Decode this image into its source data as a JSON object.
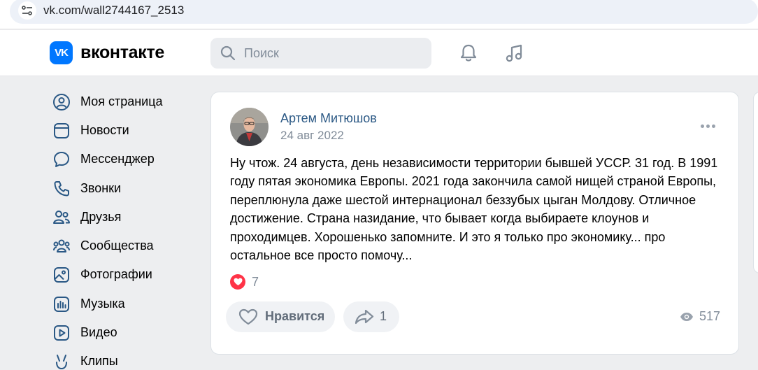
{
  "browser": {
    "url": "vk.com/wall2744167_2513"
  },
  "header": {
    "logo_text": "вконтакте",
    "logo_mark": "VK",
    "search_placeholder": "Поиск",
    "icons": [
      "search-icon",
      "bell-icon",
      "music-icon"
    ]
  },
  "sidebar": {
    "items": [
      {
        "label": "Моя страница",
        "icon": "user-circle-icon"
      },
      {
        "label": "Новости",
        "icon": "news-icon"
      },
      {
        "label": "Мессенджер",
        "icon": "message-icon"
      },
      {
        "label": "Звонки",
        "icon": "phone-icon"
      },
      {
        "label": "Друзья",
        "icon": "friends-icon"
      },
      {
        "label": "Сообщества",
        "icon": "communities-icon"
      },
      {
        "label": "Фотографии",
        "icon": "photo-icon"
      },
      {
        "label": "Музыка",
        "icon": "music-bars-icon"
      },
      {
        "label": "Видео",
        "icon": "video-icon"
      },
      {
        "label": "Клипы",
        "icon": "clips-icon"
      }
    ]
  },
  "post": {
    "author": "Артем Митюшов",
    "date": "24 авг 2022",
    "text": "Ну чтож. 24 августа, день независимости территории бывшей УССР. 31 год. В 1991 году пятая экономика Европы. 2021 года закончила самой нищей страной Европы, переплюнула даже шестой интернационал беззубых цыган Молдову. Отличное достижение. Страна назидание, что бывает когда выбираете клоунов и проходимцев. Хорошенько запомните. И это я только про экономику... про остальное все просто помочу...",
    "reactions_count": "7",
    "like_label": "Нравится",
    "shares_count": "1",
    "views_count": "517"
  },
  "colors": {
    "brand": "#0077ff",
    "author_link": "#2c5985",
    "secondary_text": "#818c99",
    "reaction": "#ff3347"
  }
}
